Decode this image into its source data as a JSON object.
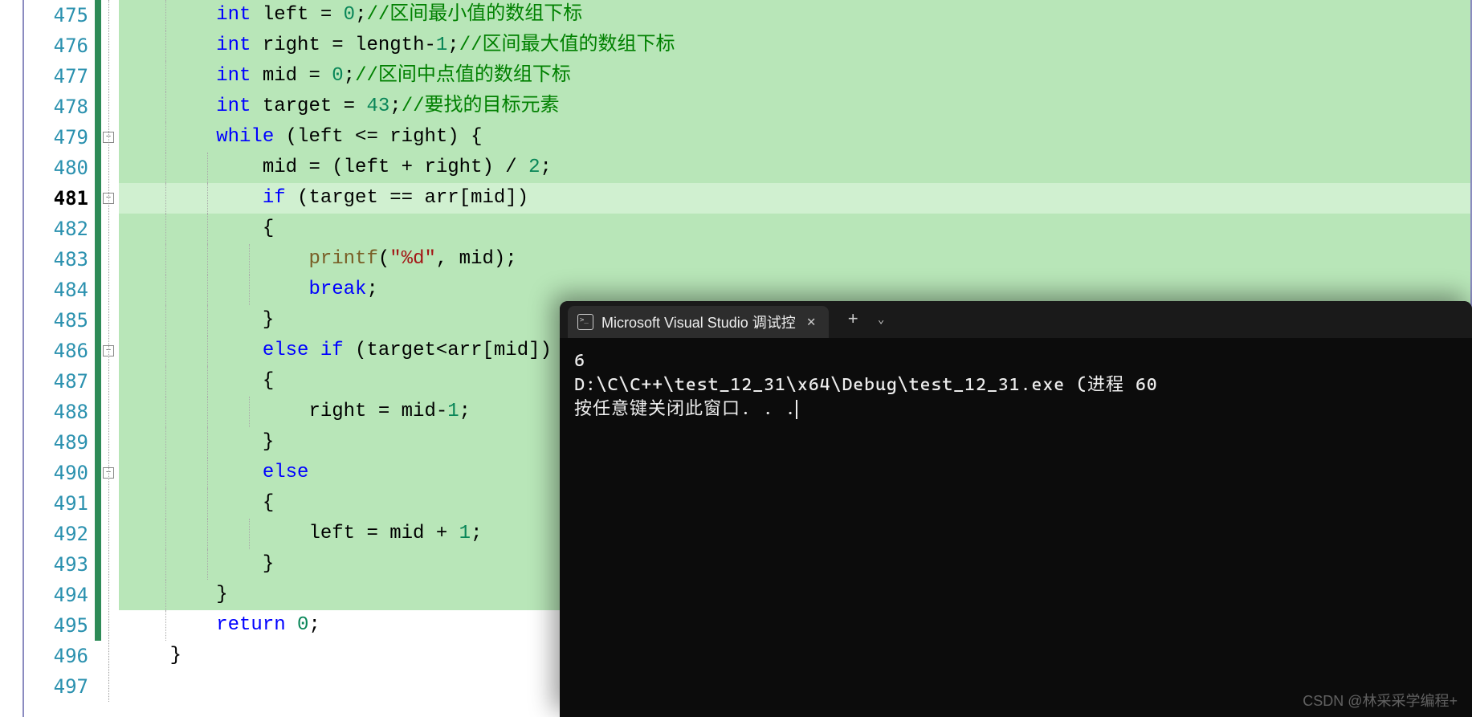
{
  "editor": {
    "line_start": 475,
    "current_line": 481,
    "change_bar_end": 495,
    "lines": [
      {
        "n": 475,
        "hl": true,
        "tokens": [
          {
            "t": "        ",
            "c": ""
          },
          {
            "t": "int",
            "c": "type"
          },
          {
            "t": " left = ",
            "c": ""
          },
          {
            "t": "0",
            "c": "num"
          },
          {
            "t": ";",
            "c": ""
          },
          {
            "t": "//区间最小值的数组下标",
            "c": "comment"
          }
        ]
      },
      {
        "n": 476,
        "hl": true,
        "tokens": [
          {
            "t": "        ",
            "c": ""
          },
          {
            "t": "int",
            "c": "type"
          },
          {
            "t": " right = length-",
            "c": ""
          },
          {
            "t": "1",
            "c": "num"
          },
          {
            "t": ";",
            "c": ""
          },
          {
            "t": "//区间最大值的数组下标",
            "c": "comment"
          }
        ]
      },
      {
        "n": 477,
        "hl": true,
        "tokens": [
          {
            "t": "        ",
            "c": ""
          },
          {
            "t": "int",
            "c": "type"
          },
          {
            "t": " mid = ",
            "c": ""
          },
          {
            "t": "0",
            "c": "num"
          },
          {
            "t": ";",
            "c": ""
          },
          {
            "t": "//区间中点值的数组下标",
            "c": "comment"
          }
        ]
      },
      {
        "n": 478,
        "hl": true,
        "tokens": [
          {
            "t": "        ",
            "c": ""
          },
          {
            "t": "int",
            "c": "type"
          },
          {
            "t": " target = ",
            "c": ""
          },
          {
            "t": "43",
            "c": "num"
          },
          {
            "t": ";",
            "c": ""
          },
          {
            "t": "//要找的目标元素",
            "c": "comment"
          }
        ]
      },
      {
        "n": 479,
        "hl": true,
        "fold": true,
        "tokens": [
          {
            "t": "        ",
            "c": ""
          },
          {
            "t": "while",
            "c": "kw"
          },
          {
            "t": " (left <= right) {",
            "c": ""
          }
        ]
      },
      {
        "n": 480,
        "hl": true,
        "tokens": [
          {
            "t": "            mid = (left + right) / ",
            "c": ""
          },
          {
            "t": "2",
            "c": "num"
          },
          {
            "t": ";",
            "c": ""
          }
        ]
      },
      {
        "n": 481,
        "hl": true,
        "current": true,
        "fold": true,
        "tokens": [
          {
            "t": "            ",
            "c": ""
          },
          {
            "t": "if",
            "c": "kw"
          },
          {
            "t": " (target == arr[mid])",
            "c": ""
          }
        ]
      },
      {
        "n": 482,
        "hl": true,
        "tokens": [
          {
            "t": "            {",
            "c": ""
          }
        ]
      },
      {
        "n": 483,
        "hl": true,
        "tokens": [
          {
            "t": "                ",
            "c": ""
          },
          {
            "t": "printf",
            "c": "func"
          },
          {
            "t": "(",
            "c": ""
          },
          {
            "t": "\"%d\"",
            "c": "str"
          },
          {
            "t": ", mid);",
            "c": ""
          }
        ]
      },
      {
        "n": 484,
        "hl": true,
        "tokens": [
          {
            "t": "                ",
            "c": ""
          },
          {
            "t": "break",
            "c": "kw"
          },
          {
            "t": ";",
            "c": ""
          }
        ]
      },
      {
        "n": 485,
        "hl": true,
        "tokens": [
          {
            "t": "            }",
            "c": ""
          }
        ]
      },
      {
        "n": 486,
        "hl": true,
        "fold": true,
        "tokens": [
          {
            "t": "            ",
            "c": ""
          },
          {
            "t": "else",
            "c": "kw"
          },
          {
            "t": " ",
            "c": ""
          },
          {
            "t": "if",
            "c": "kw"
          },
          {
            "t": " (target<arr[mid])",
            "c": ""
          }
        ]
      },
      {
        "n": 487,
        "hl": true,
        "tokens": [
          {
            "t": "            {",
            "c": ""
          }
        ]
      },
      {
        "n": 488,
        "hl": true,
        "tokens": [
          {
            "t": "                right = mid-",
            "c": ""
          },
          {
            "t": "1",
            "c": "num"
          },
          {
            "t": ";",
            "c": ""
          }
        ]
      },
      {
        "n": 489,
        "hl": true,
        "tokens": [
          {
            "t": "            }",
            "c": ""
          }
        ]
      },
      {
        "n": 490,
        "hl": true,
        "fold": true,
        "tokens": [
          {
            "t": "            ",
            "c": ""
          },
          {
            "t": "else",
            "c": "kw"
          }
        ]
      },
      {
        "n": 491,
        "hl": true,
        "tokens": [
          {
            "t": "            {",
            "c": ""
          }
        ]
      },
      {
        "n": 492,
        "hl": true,
        "tokens": [
          {
            "t": "                left = mid + ",
            "c": ""
          },
          {
            "t": "1",
            "c": "num"
          },
          {
            "t": ";",
            "c": ""
          }
        ]
      },
      {
        "n": 493,
        "hl": true,
        "tokens": [
          {
            "t": "            }",
            "c": ""
          }
        ]
      },
      {
        "n": 494,
        "hl": true,
        "tokens": [
          {
            "t": "",
            "c": ""
          }
        ]
      },
      {
        "n": 495,
        "hl": true,
        "tokens": [
          {
            "t": "        }",
            "c": ""
          }
        ]
      },
      {
        "n": 496,
        "hl": false,
        "tokens": [
          {
            "t": "        ",
            "c": ""
          },
          {
            "t": "return",
            "c": "kw"
          },
          {
            "t": " ",
            "c": ""
          },
          {
            "t": "0",
            "c": "num"
          },
          {
            "t": ";",
            "c": ""
          }
        ]
      },
      {
        "n": 497,
        "hl": false,
        "tokens": [
          {
            "t": "    }",
            "c": ""
          }
        ]
      }
    ]
  },
  "terminal": {
    "tab_title": "Microsoft Visual Studio 调试控",
    "output_line1": "6",
    "output_line2": "D:\\C\\C++\\test_12_31\\x64\\Debug\\test_12_31.exe (进程 60",
    "output_line3": "按任意键关闭此窗口. . ."
  },
  "watermark": "CSDN @林采采学编程+"
}
